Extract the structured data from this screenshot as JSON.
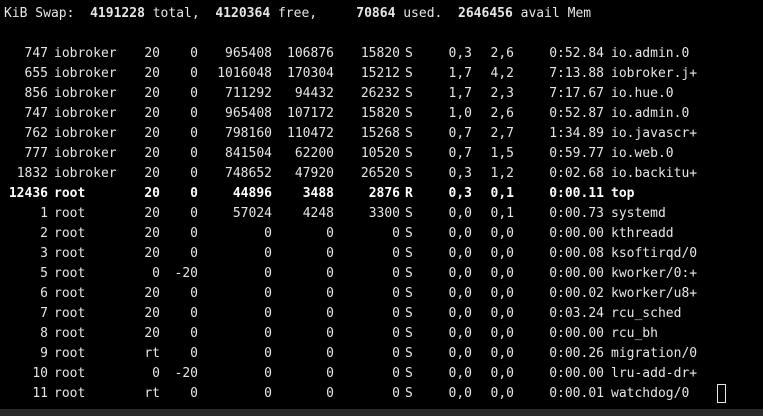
{
  "swap": {
    "label": "KiB Swap:",
    "total_value": "4191228",
    "total_label": "total,",
    "free_value": "4120364",
    "free_label": "free,",
    "used_value": "70864",
    "used_label": "used.",
    "avail_value": "2646456",
    "avail_label": "avail Mem"
  },
  "processes": [
    {
      "pid": "747",
      "user": "iobroker",
      "pr": "20",
      "ni": "0",
      "virt": "965408",
      "res": "106876",
      "shr": "15820",
      "s": "S",
      "cpu": "0,3",
      "mem": "2,6",
      "time": "0:52.84",
      "command": "io.admin.0"
    },
    {
      "pid": "655",
      "user": "iobroker",
      "pr": "20",
      "ni": "0",
      "virt": "1016048",
      "res": "170304",
      "shr": "15212",
      "s": "S",
      "cpu": "1,7",
      "mem": "4,2",
      "time": "7:13.88",
      "command": "iobroker.j+"
    },
    {
      "pid": "856",
      "user": "iobroker",
      "pr": "20",
      "ni": "0",
      "virt": "711292",
      "res": "94432",
      "shr": "26232",
      "s": "S",
      "cpu": "1,7",
      "mem": "2,3",
      "time": "7:17.67",
      "command": "io.hue.0"
    },
    {
      "pid": "747",
      "user": "iobroker",
      "pr": "20",
      "ni": "0",
      "virt": "965408",
      "res": "107172",
      "shr": "15820",
      "s": "S",
      "cpu": "1,0",
      "mem": "2,6",
      "time": "0:52.87",
      "command": "io.admin.0"
    },
    {
      "pid": "762",
      "user": "iobroker",
      "pr": "20",
      "ni": "0",
      "virt": "798160",
      "res": "110472",
      "shr": "15268",
      "s": "S",
      "cpu": "0,7",
      "mem": "2,7",
      "time": "1:34.89",
      "command": "io.javascr+"
    },
    {
      "pid": "777",
      "user": "iobroker",
      "pr": "20",
      "ni": "0",
      "virt": "841504",
      "res": "62200",
      "shr": "10520",
      "s": "S",
      "cpu": "0,7",
      "mem": "1,5",
      "time": "0:59.77",
      "command": "io.web.0"
    },
    {
      "pid": "1832",
      "user": "iobroker",
      "pr": "20",
      "ni": "0",
      "virt": "748652",
      "res": "47920",
      "shr": "26520",
      "s": "S",
      "cpu": "0,3",
      "mem": "1,2",
      "time": "0:02.68",
      "command": "io.backitu+"
    },
    {
      "pid": "12436",
      "user": "root",
      "pr": "20",
      "ni": "0",
      "virt": "44896",
      "res": "3488",
      "shr": "2876",
      "s": "R",
      "cpu": "0,3",
      "mem": "0,1",
      "time": "0:00.11",
      "command": "top"
    },
    {
      "pid": "1",
      "user": "root",
      "pr": "20",
      "ni": "0",
      "virt": "57024",
      "res": "4248",
      "shr": "3300",
      "s": "S",
      "cpu": "0,0",
      "mem": "0,1",
      "time": "0:00.73",
      "command": "systemd"
    },
    {
      "pid": "2",
      "user": "root",
      "pr": "20",
      "ni": "0",
      "virt": "0",
      "res": "0",
      "shr": "0",
      "s": "S",
      "cpu": "0,0",
      "mem": "0,0",
      "time": "0:00.00",
      "command": "kthreadd"
    },
    {
      "pid": "3",
      "user": "root",
      "pr": "20",
      "ni": "0",
      "virt": "0",
      "res": "0",
      "shr": "0",
      "s": "S",
      "cpu": "0,0",
      "mem": "0,0",
      "time": "0:00.08",
      "command": "ksoftirqd/0"
    },
    {
      "pid": "5",
      "user": "root",
      "pr": "0",
      "ni": "-20",
      "virt": "0",
      "res": "0",
      "shr": "0",
      "s": "S",
      "cpu": "0,0",
      "mem": "0,0",
      "time": "0:00.00",
      "command": "kworker/0:+"
    },
    {
      "pid": "6",
      "user": "root",
      "pr": "20",
      "ni": "0",
      "virt": "0",
      "res": "0",
      "shr": "0",
      "s": "S",
      "cpu": "0,0",
      "mem": "0,0",
      "time": "0:00.02",
      "command": "kworker/u8+"
    },
    {
      "pid": "7",
      "user": "root",
      "pr": "20",
      "ni": "0",
      "virt": "0",
      "res": "0",
      "shr": "0",
      "s": "S",
      "cpu": "0,0",
      "mem": "0,0",
      "time": "0:03.24",
      "command": "rcu_sched"
    },
    {
      "pid": "8",
      "user": "root",
      "pr": "20",
      "ni": "0",
      "virt": "0",
      "res": "0",
      "shr": "0",
      "s": "S",
      "cpu": "0,0",
      "mem": "0,0",
      "time": "0:00.00",
      "command": "rcu_bh"
    },
    {
      "pid": "9",
      "user": "root",
      "pr": "rt",
      "ni": "0",
      "virt": "0",
      "res": "0",
      "shr": "0",
      "s": "S",
      "cpu": "0,0",
      "mem": "0,0",
      "time": "0:00.26",
      "command": "migration/0"
    },
    {
      "pid": "10",
      "user": "root",
      "pr": "0",
      "ni": "-20",
      "virt": "0",
      "res": "0",
      "shr": "0",
      "s": "S",
      "cpu": "0,0",
      "mem": "0,0",
      "time": "0:00.00",
      "command": "lru-add-dr+"
    },
    {
      "pid": "11",
      "user": "root",
      "pr": "rt",
      "ni": "0",
      "virt": "0",
      "res": "0",
      "shr": "0",
      "s": "S",
      "cpu": "0,0",
      "mem": "0,0",
      "time": "0:00.01",
      "command": "watchdog/0"
    }
  ],
  "highlighted_command": "top",
  "colors": {
    "background": "#000000",
    "text": "#e6e6e6",
    "bold_text": "#ffffff"
  }
}
